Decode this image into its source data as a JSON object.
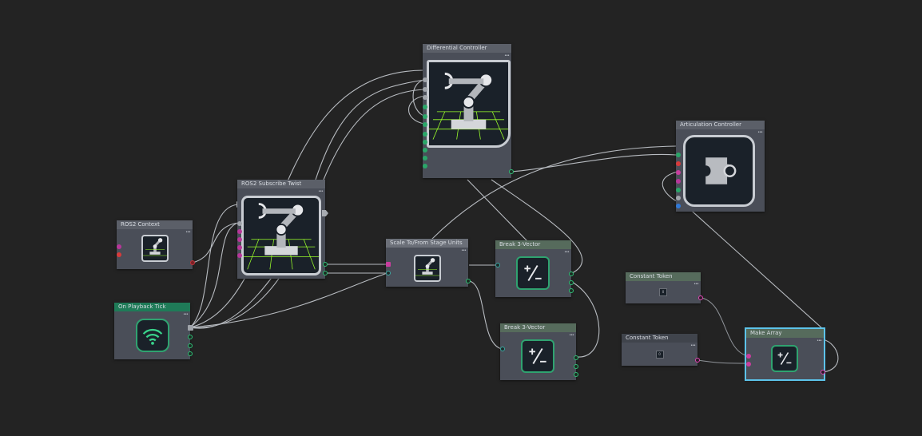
{
  "colors": {
    "canvas": "#232323",
    "node_body": "#4a4e58",
    "header_default": "#5b5f68",
    "header_green": "#1f7b58",
    "selection": "#5cc3ea",
    "wire": "#c8ccd2",
    "port_green": "#2fbf76",
    "port_pink": "#e045b4"
  },
  "icons": {
    "robot_arm": "robot-arm-icon",
    "wifi": "wifi-icon",
    "math": "plus-minus-icon",
    "puzzle": "puzzle-icon"
  },
  "nodes": {
    "differential_controller": {
      "title": "Differential Controller",
      "menu": "•••"
    },
    "articulation_controller": {
      "title": "Articulation Controller",
      "menu": "•••"
    },
    "ros2_subscribe_twist": {
      "title": "ROS2 Subscribe Twist",
      "menu": "•••"
    },
    "ros2_context": {
      "title": "ROS2 Context",
      "menu": "•••"
    },
    "on_playback_tick": {
      "title": "On Playback Tick",
      "menu": "•••"
    },
    "scale_to_stage_units": {
      "title": "Scale To/From Stage Units",
      "menu": "•••"
    },
    "break_3vector_a": {
      "title": "Break 3-Vector",
      "menu": "•••"
    },
    "break_3vector_b": {
      "title": "Break 3-Vector",
      "menu": "•••"
    },
    "constant_token_a": {
      "title": "Constant Token",
      "menu": "•••",
      "value": "0"
    },
    "constant_token_b": {
      "title": "Constant Token",
      "menu": "•••",
      "value": "0"
    },
    "make_array": {
      "title": "Make Array",
      "menu": "•••"
    }
  }
}
